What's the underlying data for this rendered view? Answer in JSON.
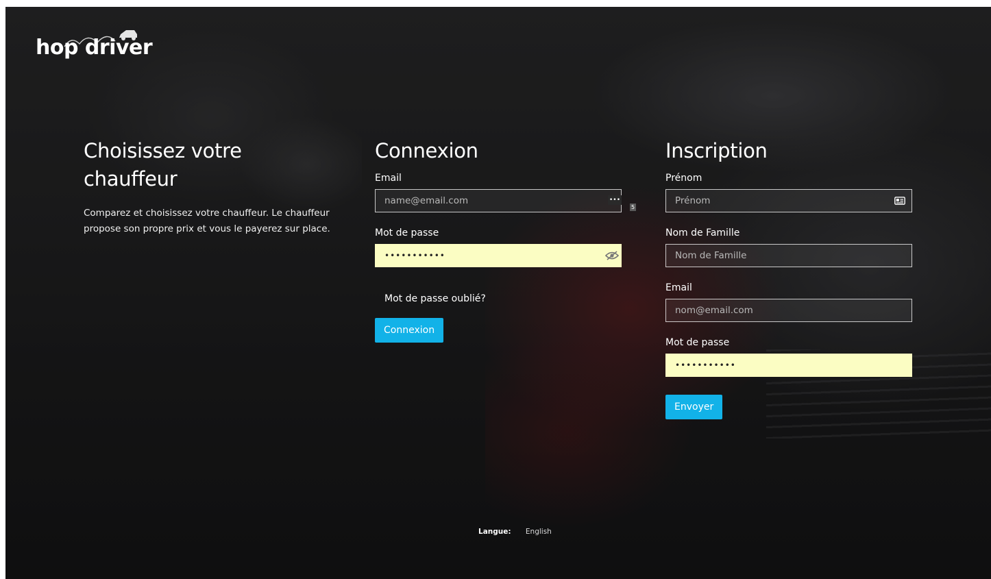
{
  "brand": {
    "logo_text": "hop driver"
  },
  "intro": {
    "title": "Choisissez votre chauffeur",
    "description": "Comparez et choisissez votre chauffeur. Le chauffeur propose son propre prix et vous le payerez sur place."
  },
  "login": {
    "title": "Connexion",
    "email_label": "Email",
    "email_placeholder": "name@email.com",
    "email_keyhint": "•••",
    "email_badge": "5",
    "password_label": "Mot de passe",
    "password_value": "•••••••••••",
    "forgot_link": "Mot de passe oublié?",
    "submit_label": "Connexion"
  },
  "signup": {
    "title": "Inscription",
    "firstname_label": "Prénom",
    "firstname_placeholder": "Prénom",
    "lastname_label": "Nom de Famille",
    "lastname_placeholder": "Nom de Famille",
    "email_label": "Email",
    "email_placeholder": "nom@email.com",
    "password_label": "Mot de passe",
    "password_value": "•••••••••••",
    "submit_label": "Envoyer"
  },
  "footer": {
    "language_label": "Langue:",
    "language_value": "English"
  },
  "colors": {
    "accent": "#12b2e8",
    "autofill": "#fbfdc3"
  },
  "icons": {
    "logo": "car-icon",
    "password_toggle": "eye-icon",
    "firstname_field": "contact-card-icon"
  }
}
